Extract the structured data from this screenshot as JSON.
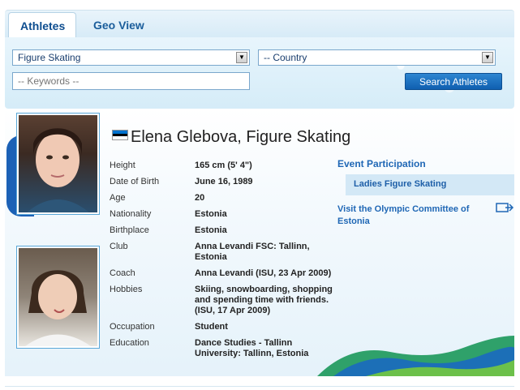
{
  "tabs": [
    {
      "label": "Athletes",
      "active": true
    },
    {
      "label": "Geo View",
      "active": false
    }
  ],
  "search": {
    "sport_value": "Figure Skating",
    "country_value": "-- Country",
    "keywords_placeholder": "-- Keywords --",
    "button_label": "Search Athletes"
  },
  "athlete": {
    "name": "Elena Glebova, Figure Skating",
    "flag_colors": [
      "#0072CE",
      "#000000",
      "#FFFFFF"
    ],
    "details": [
      {
        "label": "Height",
        "value": "165 cm (5' 4\")"
      },
      {
        "label": "Date of Birth",
        "value": "June 16, 1989"
      },
      {
        "label": "Age",
        "value": "20"
      },
      {
        "label": "Nationality",
        "value": "Estonia"
      },
      {
        "label": "Birthplace",
        "value": "Estonia"
      },
      {
        "label": "Club",
        "value": "Anna Levandi FSC: Tallinn, Estonia"
      },
      {
        "label": "Coach",
        "value": "Anna Levandi (ISU, 23 Apr 2009)"
      },
      {
        "label": "Hobbies",
        "value": "Skiing, snowboarding, shopping and spending time with friends. (ISU, 17 Apr 2009)"
      },
      {
        "label": "Occupation",
        "value": "Student"
      },
      {
        "label": "Education",
        "value": "Dance Studies - Tallinn University: Tallinn, Estonia"
      }
    ]
  },
  "events": {
    "title": "Event Participation",
    "items": [
      "Ladies Figure Skating"
    ]
  },
  "noc_link": "Visit the Olympic Committee of Estonia",
  "colors": {
    "accent": "#1f67b5",
    "button": "#0f5fb0",
    "tab_text": "#0d4d8f"
  }
}
